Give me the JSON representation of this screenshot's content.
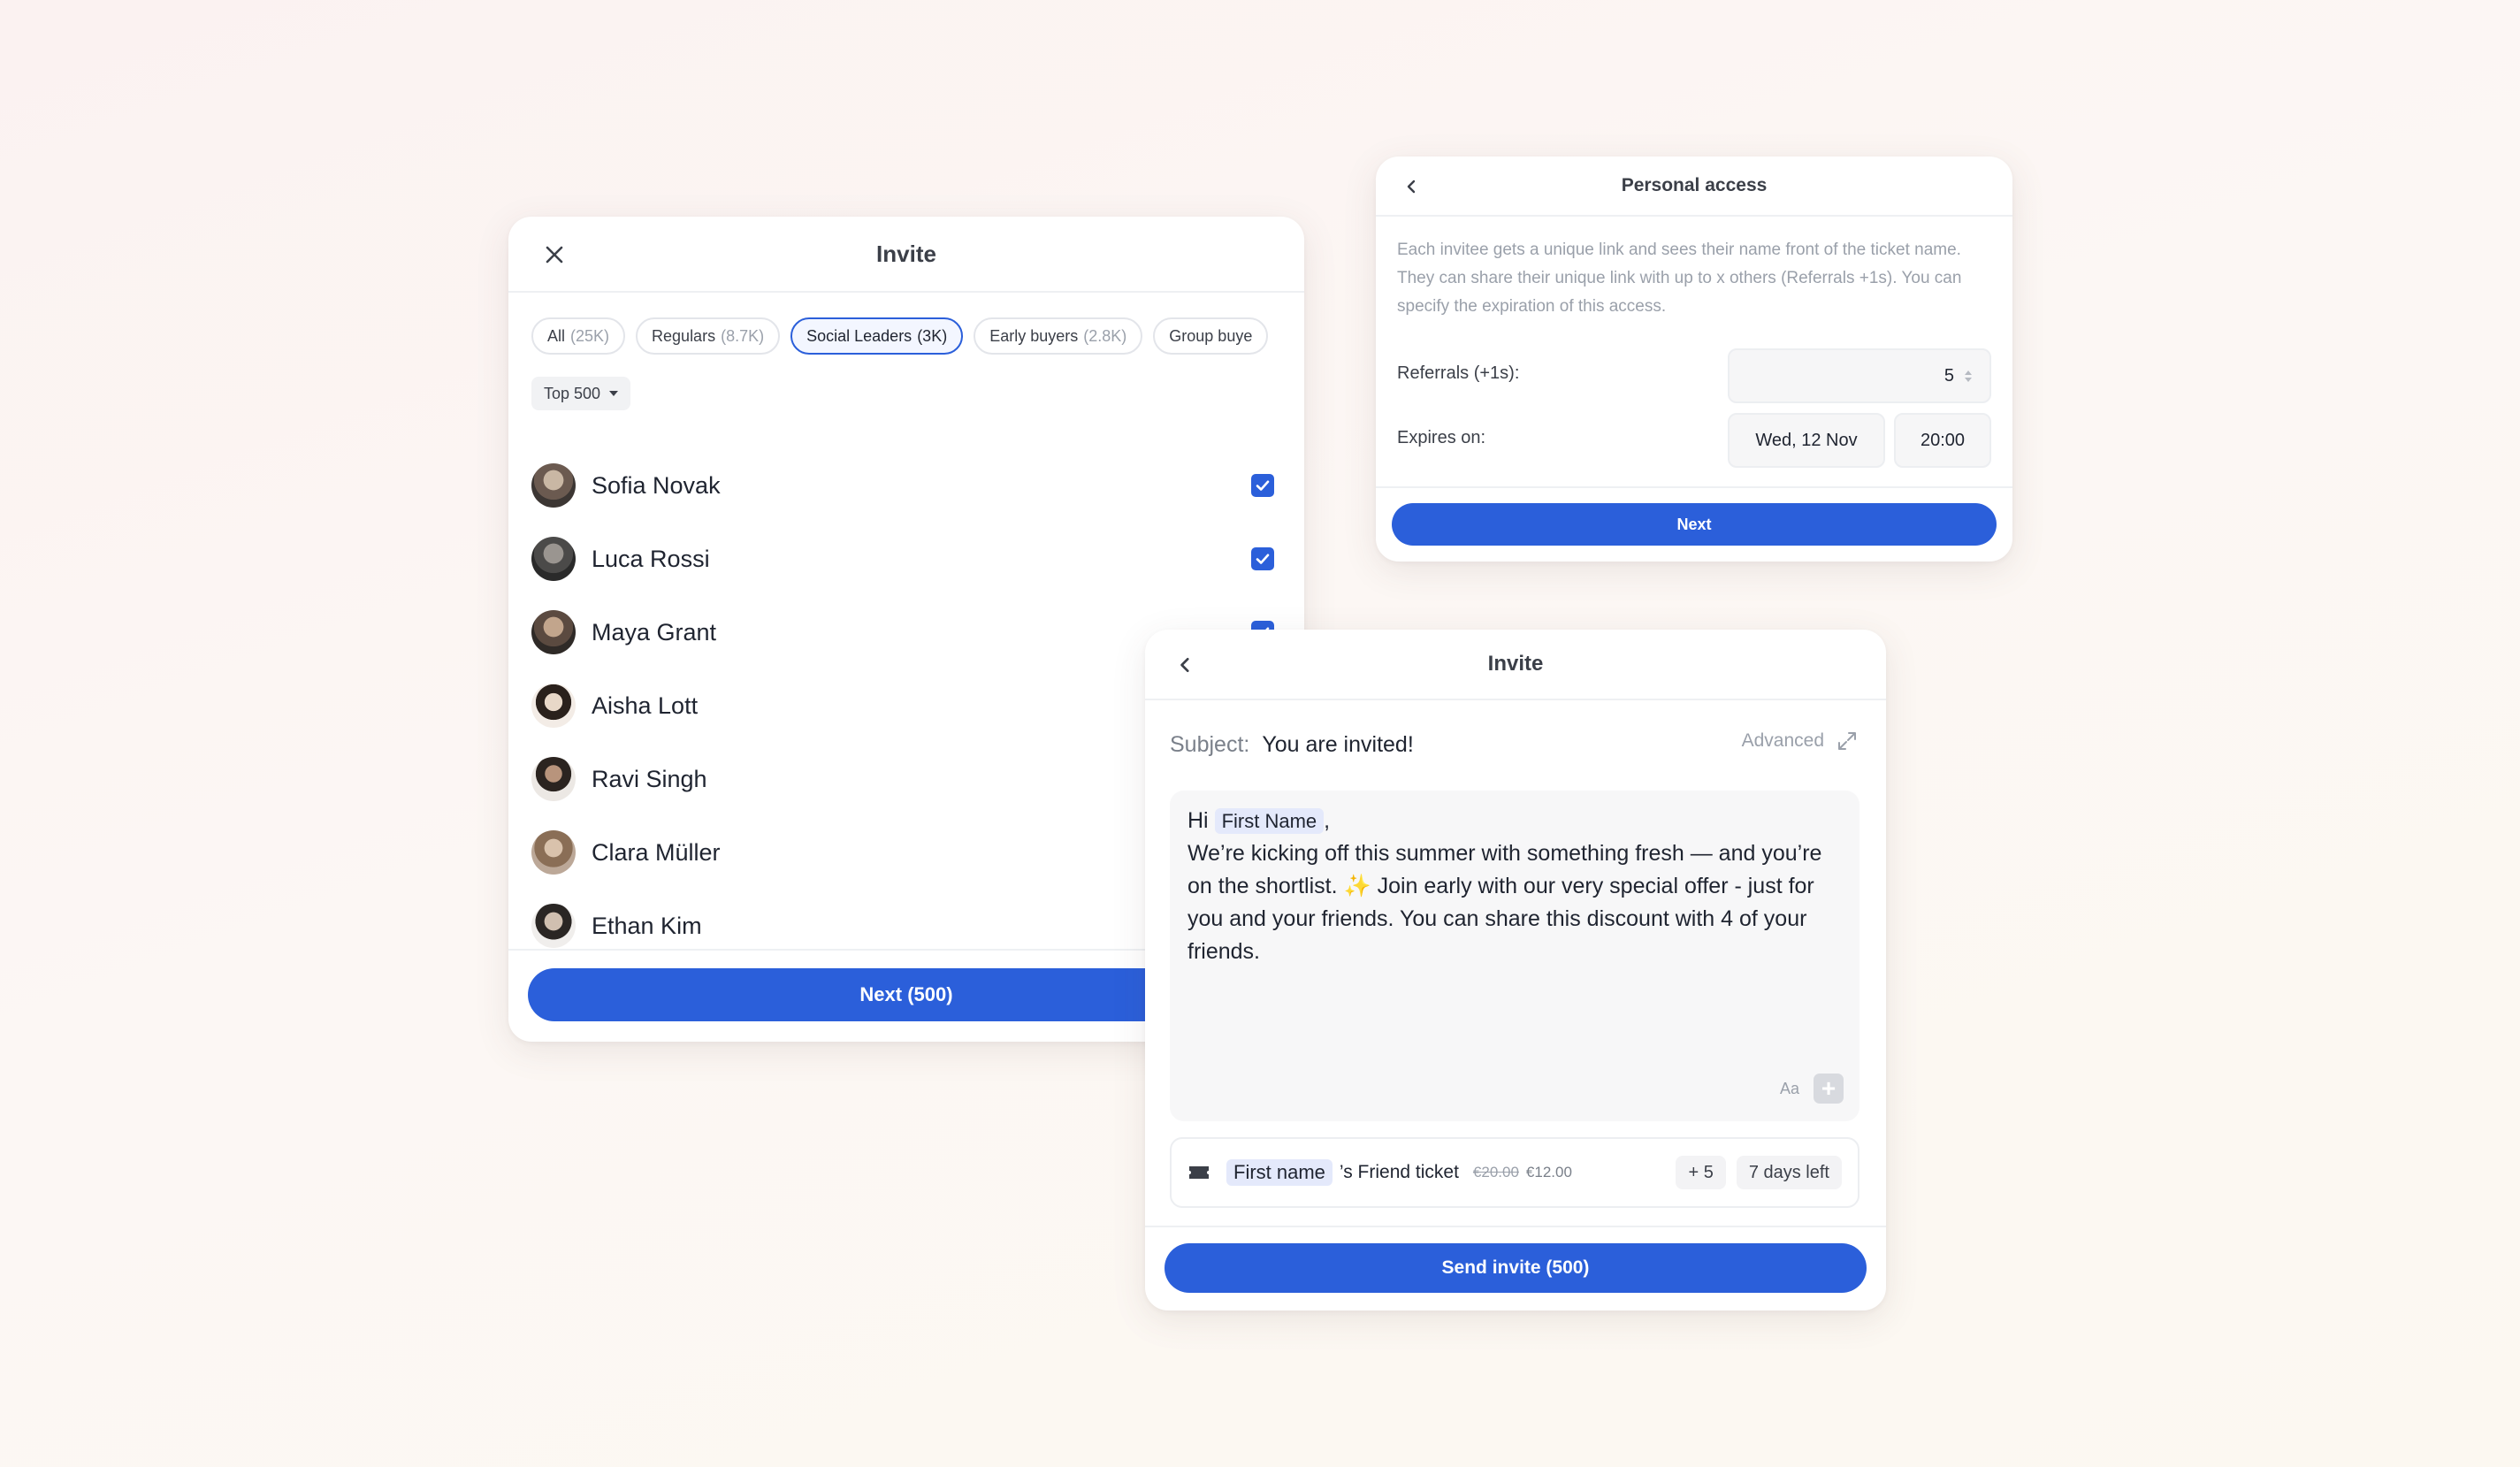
{
  "invite_list": {
    "title": "Invite",
    "chips": [
      {
        "label": "All",
        "count": "(25K)"
      },
      {
        "label": "Regulars",
        "count": "(8.7K)"
      },
      {
        "label": "Social Leaders",
        "count": "(3K)"
      },
      {
        "label": "Early buyers",
        "count": "(2.8K)"
      },
      {
        "label": "Group buye",
        "count": ""
      }
    ],
    "filter": "Top 500",
    "people": [
      {
        "name": "Sofia Novak",
        "checked": true
      },
      {
        "name": "Luca Rossi",
        "checked": true
      },
      {
        "name": "Maya Grant",
        "checked": true
      },
      {
        "name": "Aisha Lott",
        "checked": false
      },
      {
        "name": "Ravi Singh",
        "checked": false
      },
      {
        "name": "Clara Müller",
        "checked": false
      },
      {
        "name": "Ethan Kim",
        "checked": false
      }
    ],
    "next_label": "Next (500)"
  },
  "access": {
    "title": "Personal access",
    "description": "Each invitee gets a unique link and sees their name front of the ticket name. They can share their unique link with up to x others (Referrals +1s). You can specify the expiration of this access.",
    "referrals_label": "Referrals (+1s):",
    "referrals_value": "5",
    "expires_label": "Expires on:",
    "expires_date": "Wed, 12 Nov",
    "expires_time": "20:00",
    "next_label": "Next"
  },
  "compose": {
    "title": "Invite",
    "subject_label": "Subject:",
    "subject_value": "You are invited!",
    "advanced_label": "Advanced",
    "greeting": "Hi",
    "first_name_token": "First Name",
    "comma": ",",
    "body_line1": "We’re kicking off this summer with something fresh — and you’re on the shortlist.",
    "sparkle": "✨",
    "body_line2": "Join early with our very special offer - just for you and your friends. You can share this discount with 4 of your friends.",
    "aa_label": "Aa",
    "plus_label": "+",
    "ticket": {
      "token": "First name",
      "name": "’s Friend ticket",
      "old_price": "€20.00",
      "new_price": "€12.00",
      "referrals": "+ 5",
      "days_left": "7 days left"
    },
    "send_label": "Send invite (500)"
  },
  "colors": {
    "primary": "#2b5fda",
    "token_bg": "#e4e9fb"
  }
}
